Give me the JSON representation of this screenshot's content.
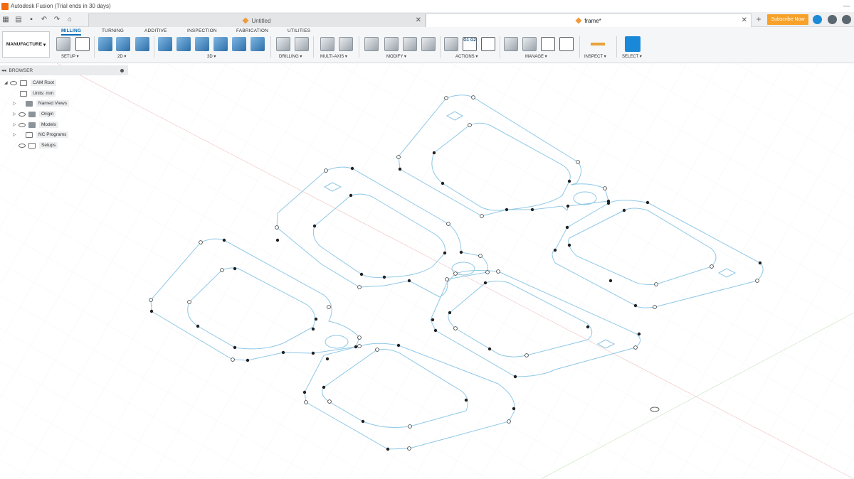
{
  "title": "Autodesk Fusion (Trial ends in 30 days)",
  "tabs": {
    "inactive": "Untitled",
    "active": "frame*",
    "subscribe": "Subscribe Now"
  },
  "ribbon": {
    "workspace": "MANUFACTURE",
    "ws_tabs": [
      "MILLING",
      "TURNING",
      "ADDITIVE",
      "INSPECTION",
      "FABRICATION",
      "UTILITIES"
    ],
    "groups": [
      "SETUP",
      "2D",
      "3D",
      "DRILLING",
      "MULTI-AXIS",
      "MODIFY",
      "ACTIONS",
      "MANAGE",
      "INSPECT",
      "SELECT"
    ],
    "g1g2": "G1 G2"
  },
  "browser": {
    "title": "BROWSER",
    "nodes": [
      "CAM Root",
      "Units: mm",
      "Named Views",
      "Origin",
      "Models",
      "NC Programs",
      "Setups"
    ]
  },
  "colors": {
    "accent": "#0b6bb3",
    "subscribe": "#f7a128",
    "sketch": "#8fc8e6"
  }
}
